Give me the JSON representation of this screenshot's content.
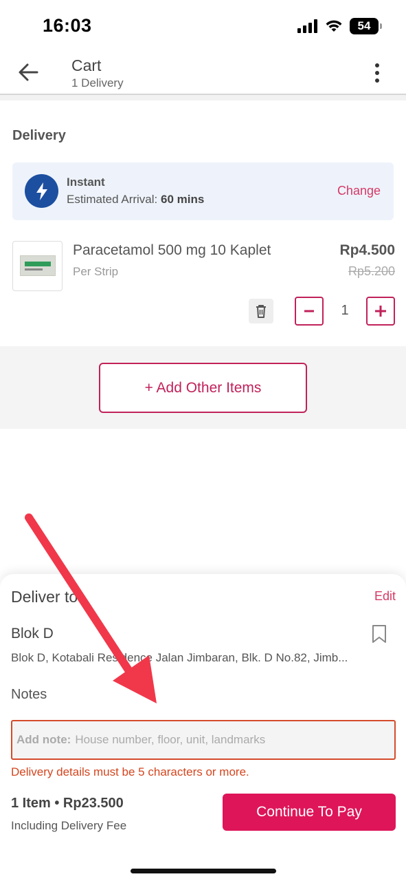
{
  "status_bar": {
    "time": "16:03",
    "battery": "54"
  },
  "header": {
    "title": "Cart",
    "subtitle": "1 Delivery"
  },
  "delivery": {
    "section_title": "Delivery",
    "method_title": "Instant",
    "arrival_label": "Estimated Arrival:",
    "arrival_value": "60 mins",
    "change_label": "Change"
  },
  "product": {
    "name": "Paracetamol 500 mg 10 Kaplet",
    "unit": "Per Strip",
    "price": "Rp4.500",
    "original_price": "Rp5.200",
    "quantity": "1"
  },
  "add_items_label": "+ Add Other Items",
  "sheet": {
    "title": "Deliver to",
    "edit_label": "Edit",
    "address_name": "Blok D",
    "address_full": "Blok D, Kotabali Residence Jalan Jimbaran, Blk. D No.82, Jimb...",
    "notes_label": "Notes",
    "note_prefix": "Add note:",
    "note_placeholder": "House number, floor, unit, landmarks",
    "error_message": "Delivery details must be 5 characters or more.",
    "summary": "1 Item • Rp23.500",
    "summary_sub": "Including Delivery Fee",
    "pay_label": "Continue To Pay"
  },
  "colors": {
    "accent": "#de1559",
    "accent_border": "#c1215a",
    "error": "#d4461f",
    "instant_icon_bg": "#1d4fa0",
    "annotation_arrow": "#f0384a"
  },
  "icons": [
    "back-arrow-icon",
    "more-vert-icon",
    "bolt-icon",
    "trash-icon",
    "minus-icon",
    "plus-icon",
    "bookmark-icon",
    "signal-icon",
    "wifi-icon",
    "battery-icon"
  ]
}
